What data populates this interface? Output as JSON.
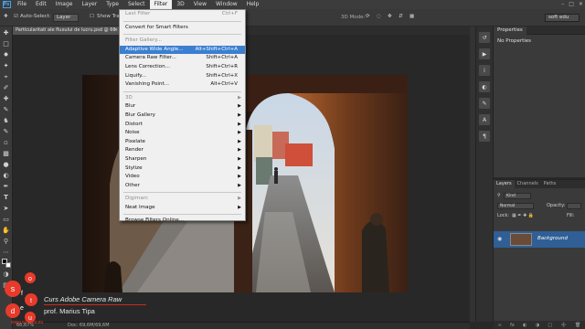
{
  "menubar": {
    "app_icon": "Ps",
    "items": [
      "File",
      "Edit",
      "Image",
      "Layer",
      "Type",
      "Select",
      "Filter",
      "3D",
      "View",
      "Window",
      "Help"
    ],
    "active": "Filter"
  },
  "optionsbar": {
    "auto_select_label": "Auto-Select:",
    "auto_select_value": "Layer",
    "show_transform": "Show Tra",
    "mode_label": "3D Mode:",
    "workspace": "soft edu"
  },
  "document": {
    "tab_title": "Particularitati ale fluxului de lucru.psd @ 66"
  },
  "filter_menu": {
    "items": [
      {
        "label": "Last Filter",
        "shortcut": "Ctrl+F",
        "disabled": true
      },
      {
        "sep": true
      },
      {
        "label": "Convert for Smart Filters"
      },
      {
        "sep": true
      },
      {
        "label": "Filter Gallery...",
        "disabled": true
      },
      {
        "label": "Adaptive Wide Angle...",
        "shortcut": "Alt+Shift+Ctrl+A",
        "highlight": true
      },
      {
        "label": "Camera Raw Filter...",
        "shortcut": "Shift+Ctrl+A"
      },
      {
        "label": "Lens Correction...",
        "shortcut": "Shift+Ctrl+R"
      },
      {
        "label": "Liquify...",
        "shortcut": "Shift+Ctrl+X"
      },
      {
        "label": "Vanishing Point...",
        "shortcut": "Alt+Ctrl+V"
      },
      {
        "sep": true
      },
      {
        "label": "3D",
        "submenu": true,
        "disabled": true
      },
      {
        "label": "Blur",
        "submenu": true
      },
      {
        "label": "Blur Gallery",
        "submenu": true
      },
      {
        "label": "Distort",
        "submenu": true
      },
      {
        "label": "Noise",
        "submenu": true
      },
      {
        "label": "Pixelate",
        "submenu": true
      },
      {
        "label": "Render",
        "submenu": true
      },
      {
        "label": "Sharpen",
        "submenu": true
      },
      {
        "label": "Stylize",
        "submenu": true
      },
      {
        "label": "Video",
        "submenu": true
      },
      {
        "label": "Other",
        "submenu": true
      },
      {
        "sep": true
      },
      {
        "label": "Digimarc",
        "submenu": true,
        "disabled": true
      },
      {
        "label": "Neat Image",
        "submenu": true
      },
      {
        "sep": true
      },
      {
        "label": "Browse Filters Online..."
      }
    ]
  },
  "properties_panel": {
    "tab": "Properties",
    "message": "No Properties"
  },
  "layers_panel": {
    "tabs": [
      "Layers",
      "Channels",
      "Paths"
    ],
    "kind": "Kind",
    "blend_mode": "Normal",
    "opacity_label": "Opacity:",
    "lock_label": "Lock:",
    "fill_label": "Fill:",
    "layer_name": "Background"
  },
  "statusbar": {
    "zoom": "66,67%",
    "doc": "Doc: 69,6M/69,6M"
  },
  "brand": {
    "course": "Curs Adobe Camera Raw",
    "author": "prof. Marius Tipa",
    "url": "www.softedu.eu",
    "logo_letters": [
      "s",
      "o",
      "f",
      "t",
      "e",
      "d",
      "u"
    ]
  },
  "colors": {
    "menu_highlight": "#3b7fd0",
    "layer_selected": "#2f5f95",
    "brand_red": "#e83a2a"
  }
}
